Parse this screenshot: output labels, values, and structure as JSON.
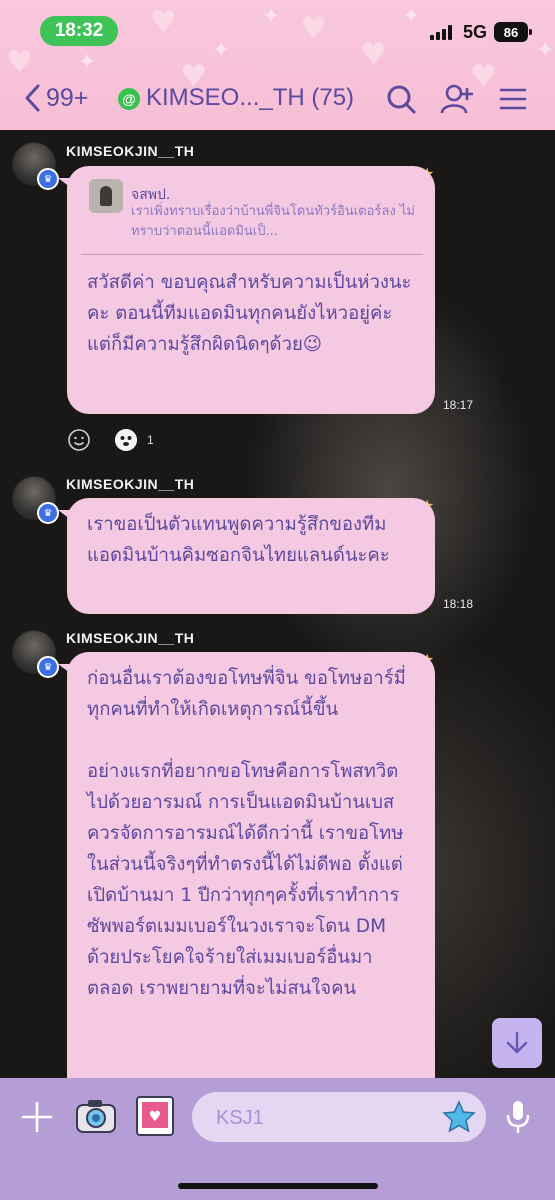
{
  "status_bar": {
    "time": "18:32",
    "network": "5G",
    "battery": "86"
  },
  "header": {
    "back_count": "99+",
    "online_badge": "@",
    "title": "KIMSEO..._TH (75)",
    "icons": [
      "search-icon",
      "add-friend-icon",
      "menu-icon"
    ]
  },
  "messages": [
    {
      "sender": "KIMSEOKJIN__TH",
      "reply": {
        "name": "จสพป.",
        "text": "เราเพิ่งทราบเรื่องว่าบ้านพี่จินโดนทัวร์อินเตอร์ลง ไม่ทราบว่าตอนนี้แอดมินเป็..."
      },
      "text": "สวัสดีค่า ขอบคุณสำหรับความเป็นห่วงนะคะ ตอนนี้ทีมแอดมินทุกคนยังไหวอยู่ค่ะ แต่ก็มีความรู้สึกผิดนิดๆด้วย😉",
      "time": "18:17",
      "reaction_count": "1"
    },
    {
      "sender": "KIMSEOKJIN__TH",
      "text": "เราขอเป็นตัวแทนพูดความรู้สึกของทีมแอดมินบ้านคิมซอกจินไทยแลนด์นะคะ",
      "time": "18:18"
    },
    {
      "sender": "KIMSEOKJIN__TH",
      "paragraphs": [
        "ก่อนอื่นเราต้องขอโทษพี่จิน ขอโทษอาร์มี่ทุกคนที่ทำให้เกิดเหตุการณ์นี้ขึ้น",
        "อย่างแรกที่อยากขอโทษคือการโพสทวิตไปด้วยอารมณ์ การเป็นแอดมินบ้านเบสควรจัดการอารมณ์ได้ดีกว่านี้ เราขอโทษในส่วนนี้จริงๆที่ทำตรงนี้ได้ไม่ดีพอ ตั้งแต่เปิดบ้านมา 1 ปีกว่าทุกๆครั้งที่เราทำการซัพพอร์ตเมมเบอร์ในวงเราจะโดน DM ด้วยประโยคใจร้ายใส่เมมเบอร์อื่นมาตลอด เราพยายามที่จะไม่สนใจคน"
      ]
    }
  ],
  "input": {
    "placeholder": "KSJ1"
  },
  "colors": {
    "header_bg": "#f6bed6",
    "accent_text": "#5b4a9e",
    "bubble_bg": "#f6c9e2",
    "input_bar_bg": "#b59ed6",
    "time_pill": "#3ec456"
  }
}
